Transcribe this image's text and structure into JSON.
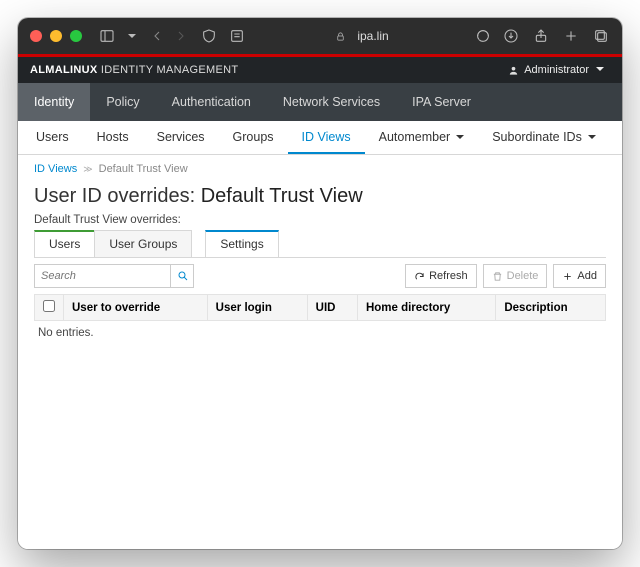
{
  "browser": {
    "url_host": "ipa.lin"
  },
  "header": {
    "brand_strong": "ALMALINUX",
    "brand_light": "IDENTITY MANAGEMENT",
    "admin_label": "Administrator"
  },
  "nav_primary": [
    "Identity",
    "Policy",
    "Authentication",
    "Network Services",
    "IPA Server"
  ],
  "nav_secondary": [
    "Users",
    "Hosts",
    "Services",
    "Groups",
    "ID Views",
    "Automember",
    "Subordinate IDs"
  ],
  "breadcrumb": {
    "root": "ID Views",
    "leaf": "Default Trust View"
  },
  "page": {
    "title_prefix": "User ID overrides: ",
    "title_strong": "Default Trust View",
    "subtitle": "Default Trust View overrides:"
  },
  "inner_tabs": [
    "Users",
    "User Groups",
    "Settings"
  ],
  "search": {
    "placeholder": "Search"
  },
  "buttons": {
    "refresh": "Refresh",
    "delete": "Delete",
    "add": "Add"
  },
  "table": {
    "columns": [
      "User to override",
      "User login",
      "UID",
      "Home directory",
      "Description"
    ],
    "empty": "No entries."
  }
}
